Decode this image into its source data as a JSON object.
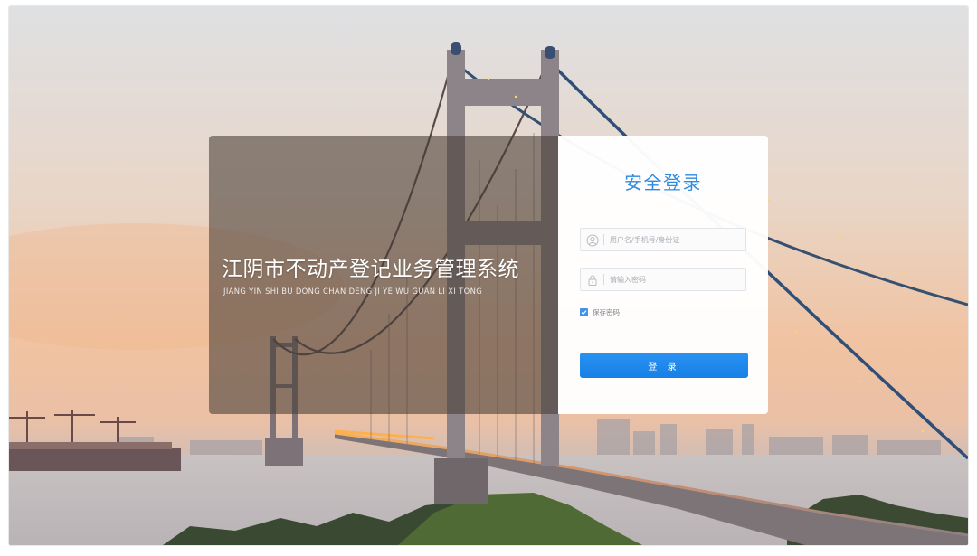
{
  "system": {
    "title_cn": "江阴市不动产登记业务管理系统",
    "title_pinyin": "JIANG YIN SHI BU DONG CHAN DENG JI YE WU GUAN LI  XI TONG"
  },
  "login": {
    "title": "安全登录",
    "username_placeholder": "用户名/手机号/身份证",
    "password_placeholder": "请输入密码",
    "remember_label": "保存密码",
    "remember_checked": true,
    "submit_label": "登 录"
  },
  "icons": {
    "username": "user-icon",
    "password": "lock-icon",
    "remember": "checkmark-icon"
  },
  "colors": {
    "accent": "#2f8ae0",
    "button": "#1e88ee",
    "panel_overlay": "rgba(70,60,54,0.58)",
    "sky_top": "#e9d8c8",
    "sky_bottom": "#f3c6a0"
  }
}
